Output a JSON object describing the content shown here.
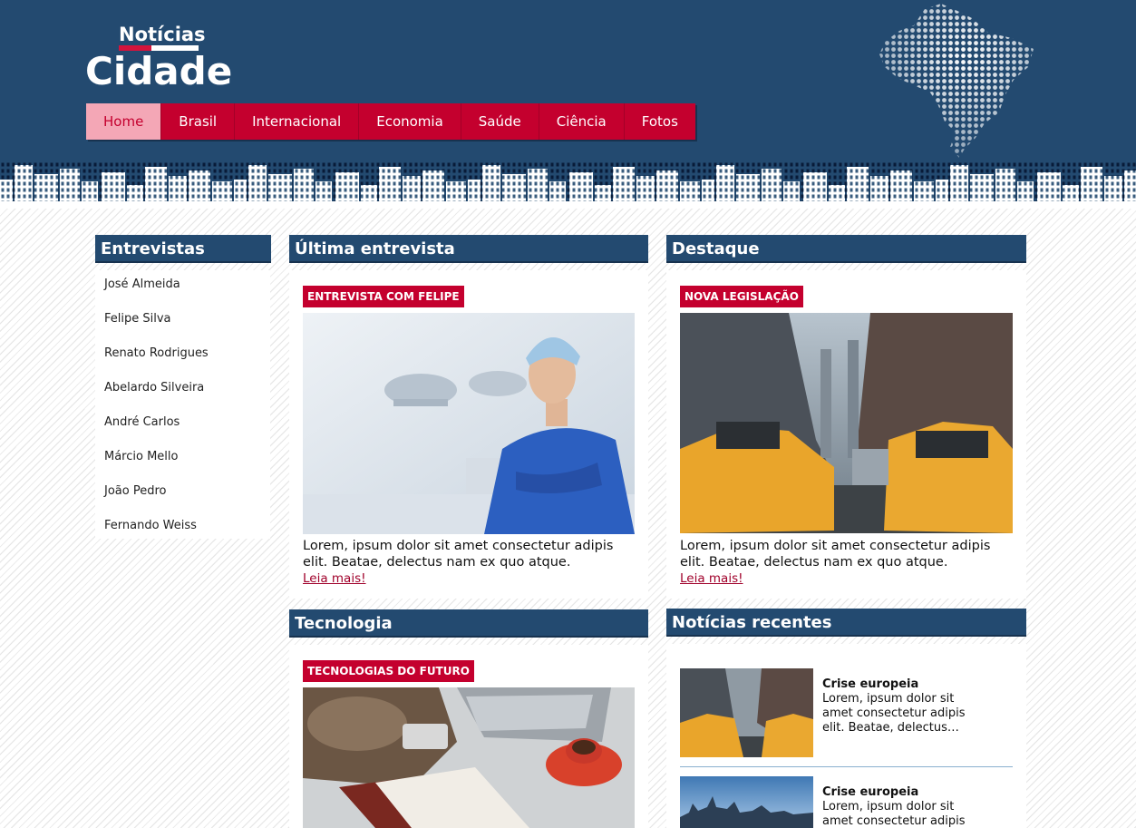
{
  "logo": {
    "top": "Notícias",
    "bottom": "Cidade"
  },
  "nav": {
    "items": [
      {
        "label": "Home"
      },
      {
        "label": "Brasil"
      },
      {
        "label": "Internacional"
      },
      {
        "label": "Economia"
      },
      {
        "label": "Saúde"
      },
      {
        "label": "Ciência"
      },
      {
        "label": "Fotos"
      }
    ],
    "active": "Home"
  },
  "sidebar": {
    "title": "Entrevistas",
    "items": [
      {
        "label": "José Almeida"
      },
      {
        "label": "Felipe Silva"
      },
      {
        "label": "Renato Rodrigues"
      },
      {
        "label": "Abelardo Silveira"
      },
      {
        "label": "André Carlos"
      },
      {
        "label": "Márcio Mello"
      },
      {
        "label": "João Pedro"
      },
      {
        "label": "Fernando Weiss"
      }
    ]
  },
  "ultima": {
    "title": "Última entrevista",
    "tag": "ENTREVISTA COM FELIPE",
    "text": "Lorem, ipsum dolor sit amet consectetur adipis elit. Beatae, delectus nam ex quo atque.",
    "link": "Leia mais!"
  },
  "destaque": {
    "title": "Destaque",
    "tag": "NOVA LEGISLAÇÃO",
    "text": "Lorem, ipsum dolor sit amet consectetur adipis elit. Beatae, delectus nam ex quo atque.",
    "link": "Leia mais!"
  },
  "tecnologia": {
    "title": "Tecnologia",
    "tag": "TECNOLOGIAS DO FUTURO"
  },
  "recentes": {
    "title": "Notícias recentes",
    "items": [
      {
        "title": "Crise europeia",
        "excerpt": "Lorem, ipsum dolor sit amet consectetur adipis elit. Beatae, delectus…"
      },
      {
        "title": "Crise europeia",
        "excerpt": "Lorem, ipsum dolor sit amet consectetur adipis"
      }
    ]
  },
  "colors": {
    "header": "#234a70",
    "accent": "#c4002e",
    "active_nav": "#f4a7b6"
  }
}
